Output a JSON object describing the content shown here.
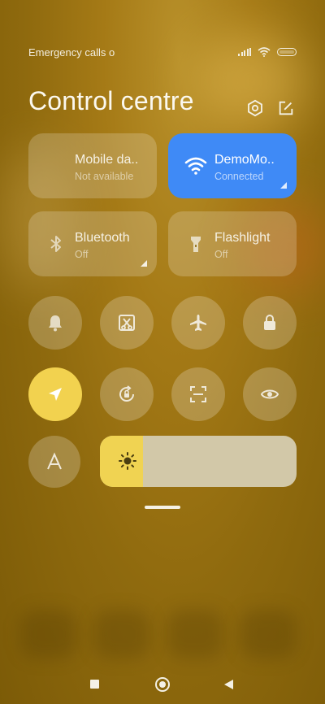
{
  "status_bar": {
    "carrier_text": "Emergency calls o"
  },
  "header": {
    "title": "Control centre",
    "settings_icon": "gear-icon",
    "edit_icon": "edit-icon"
  },
  "tiles": [
    {
      "title": "Mobile da..",
      "subtitle": "Not available",
      "icon": "mobile-data-icon",
      "active": false
    },
    {
      "title": "DemoMo..",
      "subtitle": "Connected",
      "icon": "wifi-icon",
      "active": true,
      "accent": "#3f8af6"
    },
    {
      "title": "Bluetooth",
      "subtitle": "Off",
      "icon": "bluetooth-icon",
      "active": false
    },
    {
      "title": "Flashlight",
      "subtitle": "Off",
      "icon": "flashlight-icon",
      "active": false
    }
  ],
  "toggles": [
    {
      "icon": "bell-icon",
      "active": false
    },
    {
      "icon": "screenshot-icon",
      "active": false
    },
    {
      "icon": "airplane-icon",
      "active": false
    },
    {
      "icon": "lock-icon",
      "active": false
    },
    {
      "icon": "location-icon",
      "active": true,
      "accent": "#f2d24f"
    },
    {
      "icon": "rotation-lock-icon",
      "active": false
    },
    {
      "icon": "scanner-icon",
      "active": false
    },
    {
      "icon": "eye-icon",
      "active": false
    },
    {
      "icon": "auto-brightness-icon",
      "active": false
    }
  ],
  "brightness": {
    "level_percent": 22,
    "icon": "sun-icon"
  },
  "navigation": {
    "recents": "square-icon",
    "home": "home-icon",
    "back": "back-icon"
  }
}
